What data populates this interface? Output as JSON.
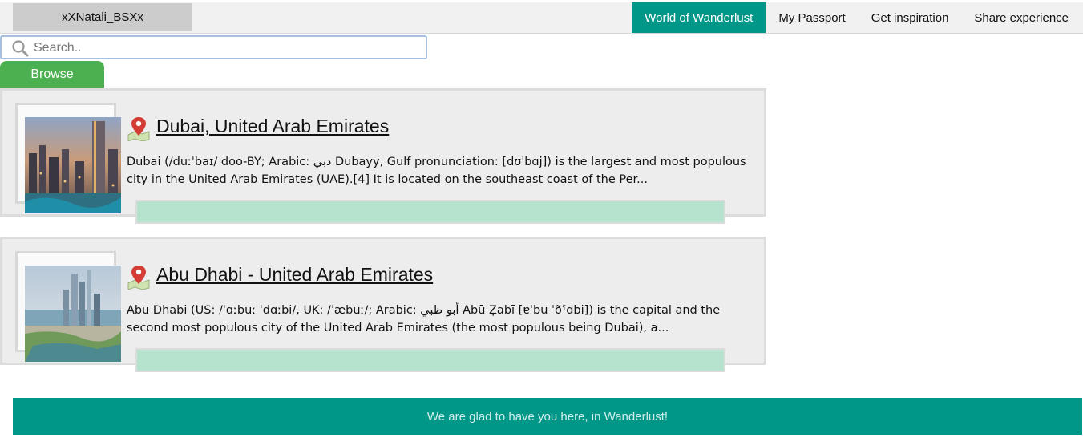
{
  "header": {
    "username": "xXNatali_BSXx",
    "nav": [
      {
        "label": "World of Wanderlust",
        "active": true
      },
      {
        "label": "My Passport",
        "active": false
      },
      {
        "label": "Get inspiration",
        "active": false
      },
      {
        "label": "Share experience",
        "active": false
      }
    ]
  },
  "search": {
    "placeholder": "Search..",
    "value": "",
    "browse_label": "Browse"
  },
  "places": [
    {
      "title": "Dubai, United Arab Emirates",
      "description": "Dubai (/duːˈbaɪ/ doo-BY; Arabic: دبي Dubayy, Gulf pronunciation: [dʊˈbɑj]) is the largest and most populous city in the United Arab Emirates (UAE).[4] It is located on the southeast coast of the Per...",
      "icon": "map-pin-icon"
    },
    {
      "title": "Abu Dhabi - United Arab Emirates",
      "description": "Abu Dhabi (US: /ˈɑːbuː ˈdɑːbi/, UK: /ˈæbuː/; Arabic: أبو ظبي Abū Ẓabī [ɐˈbu ˈðˤɑbi]) is the capital and the second most populous city of the United Arab Emirates (the most populous being Dubai), a...",
      "icon": "map-pin-icon"
    }
  ],
  "footer": {
    "message": "We are glad to have you here, in Wanderlust!"
  },
  "colors": {
    "accent": "#009688",
    "browse": "#4caf50",
    "bar": "#b5e3cd"
  }
}
